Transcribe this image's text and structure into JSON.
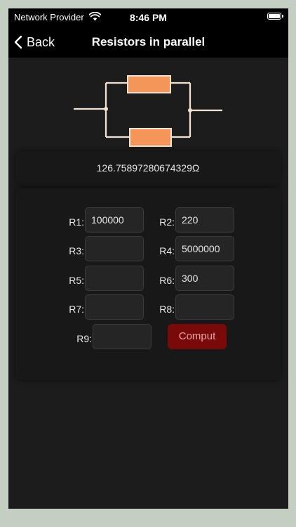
{
  "status_bar": {
    "carrier": "Network Provider",
    "time": "8:46 PM"
  },
  "nav": {
    "back_label": "Back",
    "title": "Resistors in parallel"
  },
  "result": {
    "value": "126.75897280674329Ω"
  },
  "fields": [
    {
      "label": "R1:",
      "value": "100000"
    },
    {
      "label": "R2:",
      "value": "220"
    },
    {
      "label": "R3:",
      "value": ""
    },
    {
      "label": "R4:",
      "value": "5000000"
    },
    {
      "label": "R5:",
      "value": ""
    },
    {
      "label": "R6:",
      "value": "300"
    },
    {
      "label": "R7:",
      "value": ""
    },
    {
      "label": "R8:",
      "value": ""
    },
    {
      "label": "R9:",
      "value": ""
    }
  ],
  "compute_label": "Comput",
  "colors": {
    "resistor": "#f4955a",
    "wire": "#f3e2d4",
    "compute_bg": "#7a0a0a"
  }
}
